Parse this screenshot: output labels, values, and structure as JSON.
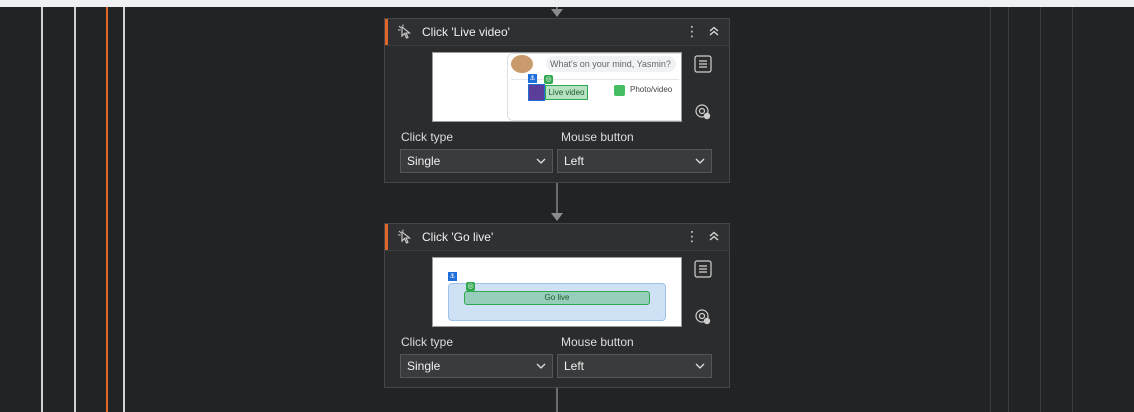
{
  "steps": [
    {
      "title": "Click 'Live video'",
      "menu_glyph": "⋮",
      "fields": {
        "click_type_label": "Click type",
        "mouse_button_label": "Mouse button",
        "click_type_value": "Single",
        "mouse_button_value": "Left"
      },
      "preview": {
        "prompt": "What's on your mind, Yasmin?",
        "live_label": "Live video",
        "photo_label": "Photo/video"
      }
    },
    {
      "title": "Click 'Go live'",
      "menu_glyph": "⋮",
      "fields": {
        "click_type_label": "Click type",
        "mouse_button_label": "Mouse button",
        "click_type_value": "Single",
        "mouse_button_value": "Left"
      },
      "preview": {
        "button_label": "Go live"
      }
    }
  ],
  "colors": {
    "accent": "#e0662a",
    "background": "#222324",
    "card": "#2b2c2e",
    "anchor": "#1e6fd9",
    "target": "#2fa84f"
  },
  "icons": {
    "activity": "click-activity-icon",
    "collapse": "chevron-double-up-icon",
    "menu": "more-vertical-icon",
    "properties": "properties-list-icon",
    "indicate": "indicate-target-icon",
    "dropdown": "chevron-down-icon",
    "anchor": "anchor-icon",
    "target": "target-icon"
  }
}
